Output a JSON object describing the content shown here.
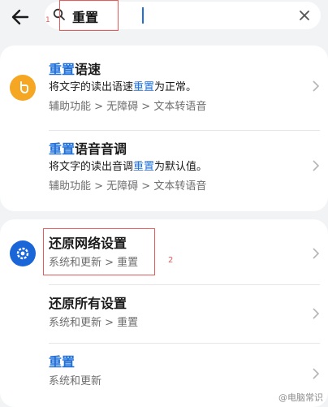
{
  "search": {
    "query": "重置",
    "clear_icon": "close-icon",
    "search_icon": "search-icon"
  },
  "annotations": {
    "marker1": "1",
    "marker2": "2"
  },
  "results_group1": {
    "items": [
      {
        "title_hl": "重置",
        "title_rest": "语速",
        "desc_a": "将文字的读出语速",
        "desc_hl": "重置",
        "desc_b": "为正常。",
        "path": "辅助功能 > 无障碍 > 文本转语音"
      },
      {
        "title_hl": "重置",
        "title_rest": "语音音调",
        "desc_a": "将文字的读出音调",
        "desc_hl": "重置",
        "desc_b": "为默认值。",
        "path": "辅助功能 > 无障碍 > 文本转语音"
      }
    ],
    "icon_color": "#f5a623"
  },
  "results_group2": {
    "items": [
      {
        "title": "还原网络设置",
        "path": "系统和更新 > 重置"
      },
      {
        "title": "还原所有设置",
        "path": "系统和更新 > 重置"
      },
      {
        "title": "重置",
        "path": "系统和更新"
      }
    ],
    "icon_color": "#1a66d9"
  },
  "watermark": {
    "text": "@电脑常识"
  }
}
